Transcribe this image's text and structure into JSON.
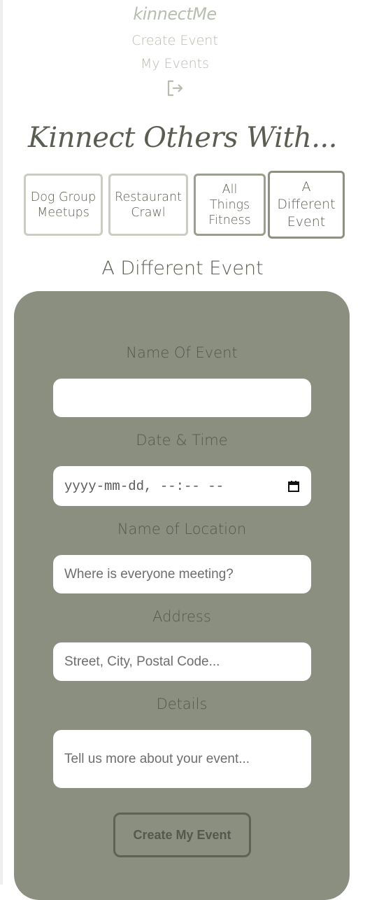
{
  "nav": {
    "brand": "kinnectMe",
    "create_event": "Create Event",
    "my_events": "My Events",
    "logout_icon": "logout-icon"
  },
  "hero": {
    "title": "Kinnect Others With..."
  },
  "event_types": [
    {
      "line1": "Dog Group",
      "line2": "Meetups",
      "line3": ""
    },
    {
      "line1": "Restaurant",
      "line2": "Crawl",
      "line3": ""
    },
    {
      "line1": "All",
      "line2": "Things",
      "line3": "Fitness"
    },
    {
      "line1": "A",
      "line2": "Different",
      "line3": "Event"
    }
  ],
  "selected_event_type": "A Different Event",
  "form": {
    "heading": "A Different Event",
    "name_label": "Name Of Event",
    "name_value": "",
    "datetime_label": "Date & Time",
    "datetime_placeholder": "yyyy-mm-dd, --:-- --",
    "location_label": "Name of Location",
    "location_placeholder": "Where is everyone meeting?",
    "address_label": "Address",
    "address_placeholder": "Street, City, Postal Code...",
    "details_label": "Details",
    "details_placeholder": "Tell us more about your event...",
    "submit_label": "Create My Event"
  },
  "colors": {
    "card_background": "#8b8f80",
    "text_dark": "#5a5e52",
    "nav_text": "#b8bcb0"
  }
}
